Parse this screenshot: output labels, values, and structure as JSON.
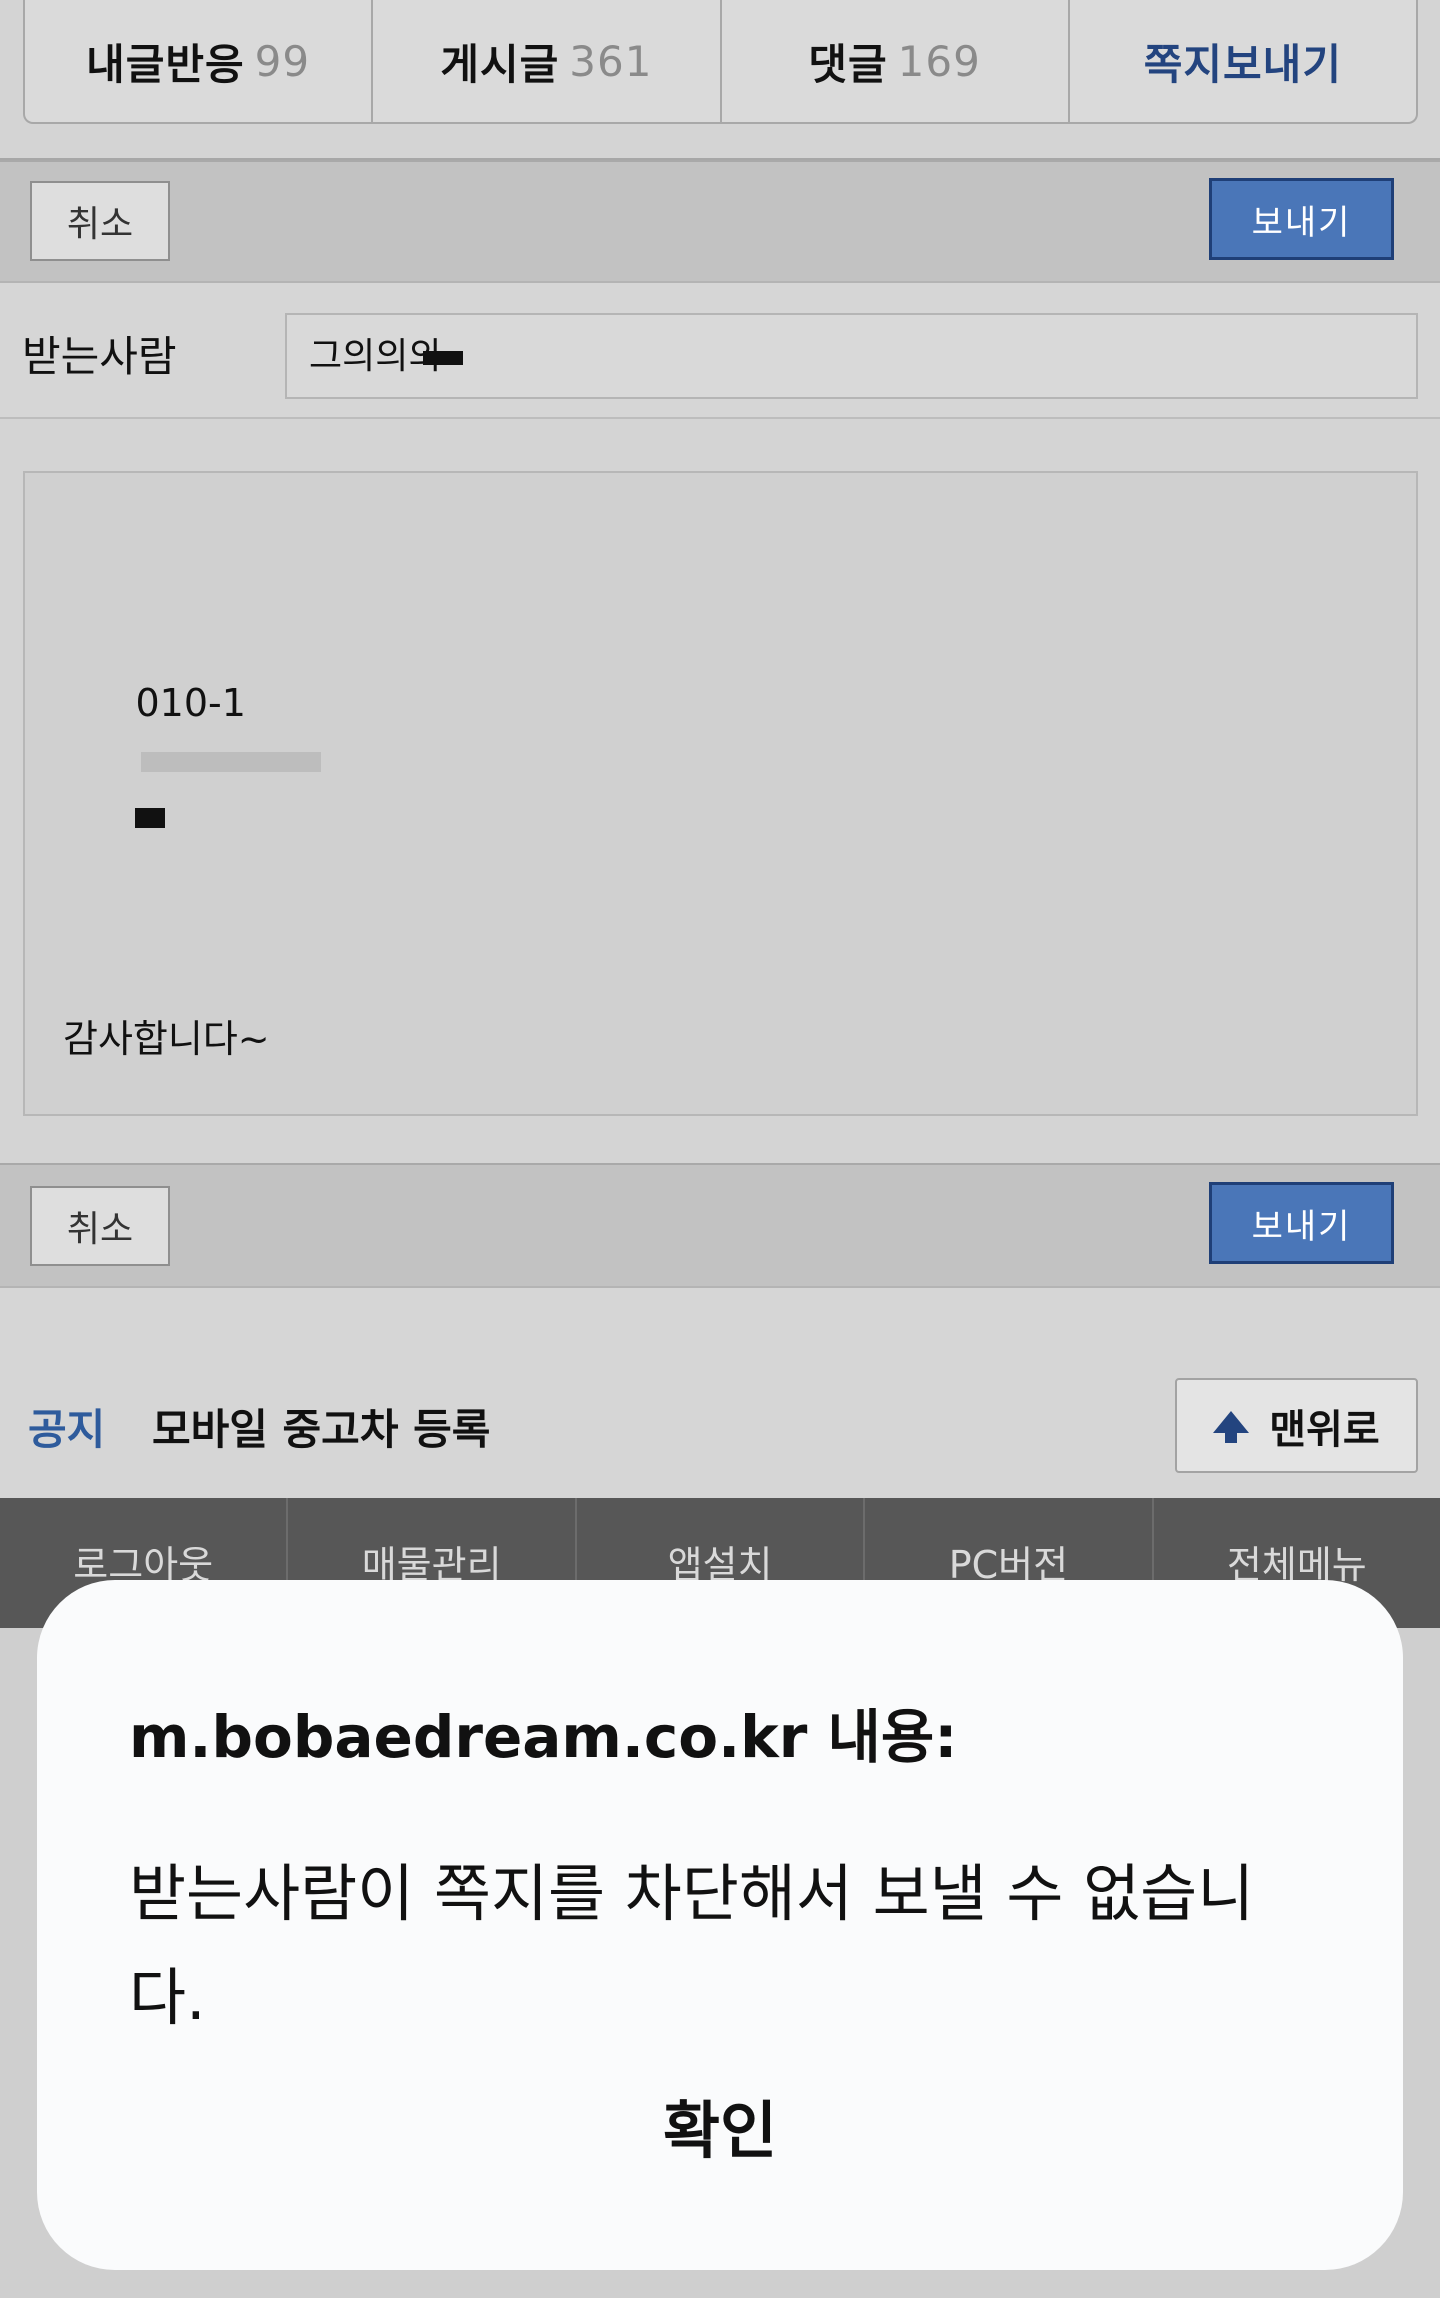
{
  "tabs": [
    {
      "label": "내글반응",
      "count": "99"
    },
    {
      "label": "게시글",
      "count": "361"
    },
    {
      "label": "댓글",
      "count": "169"
    },
    {
      "label": "쪽지보내기",
      "count": ""
    }
  ],
  "actions": {
    "cancel_label": "취소",
    "send_label": "보내기"
  },
  "recipient": {
    "label": "받는사람",
    "value": "그의의의"
  },
  "message": {
    "body": "010-1"
  },
  "message_line2": "감사합니다~",
  "notice": {
    "tag": "공지",
    "text": "모바일 중고차 등록",
    "top_button_label": "맨위로"
  },
  "bottom_nav": [
    "로그아웃",
    "매물관리",
    "앱설치",
    "PC버전",
    "전체메뉴"
  ],
  "dialog": {
    "title": "m.bobaedream.co.kr 내용:",
    "message": "받는사람이 쪽지를 차단해서 보낼 수 없습니다.",
    "ok_label": "확인"
  },
  "colors": {
    "accent_blue": "#4a76b8",
    "active_tab": "#23447f",
    "notice_tag": "#2e5b9c"
  }
}
